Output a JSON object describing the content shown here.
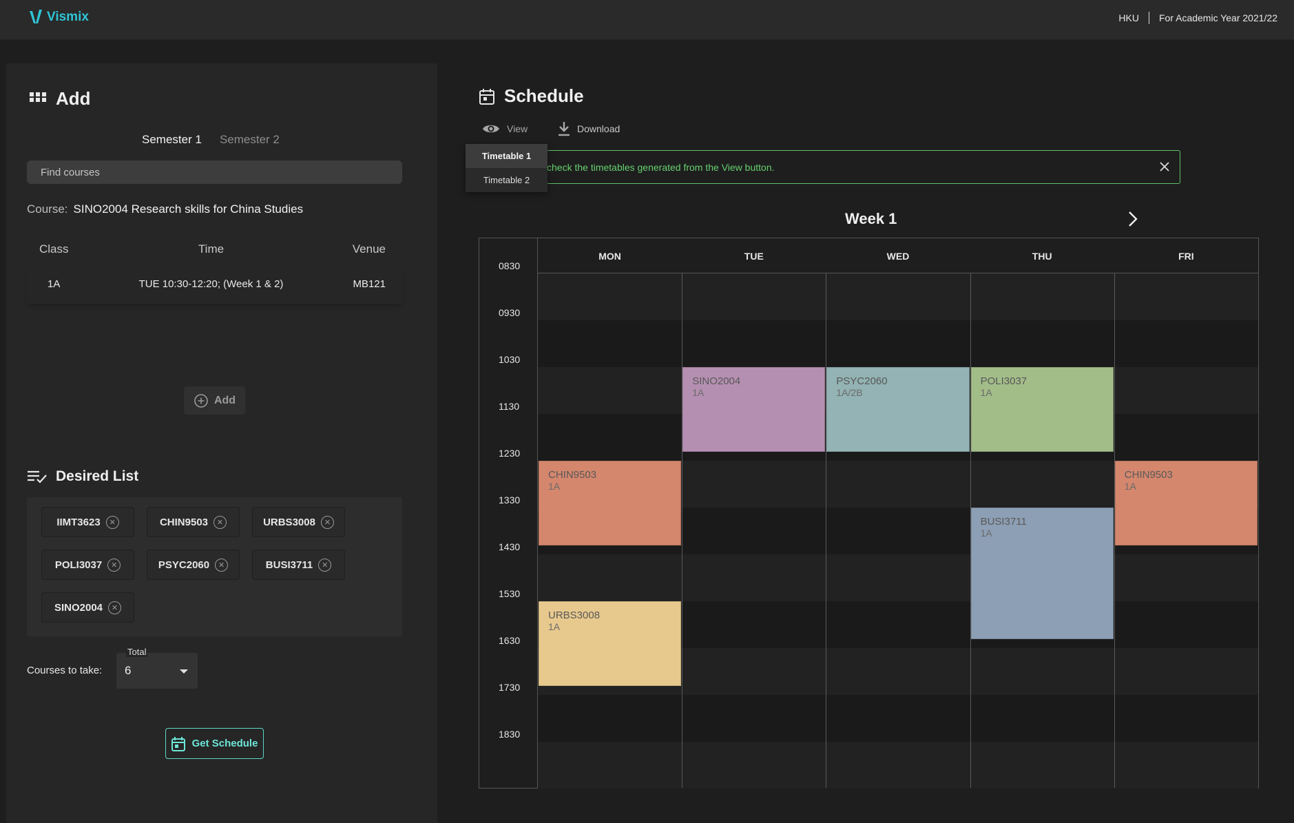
{
  "header": {
    "logo_text": "Vismix",
    "institution": "HKU",
    "academic_year": "For Academic Year 2021/22"
  },
  "add_panel": {
    "title": "Add",
    "semester_tabs": [
      {
        "label": "Semester 1",
        "active": true
      },
      {
        "label": "Semester 2",
        "active": false
      }
    ],
    "search_placeholder": "Find courses",
    "course_label": "Course:",
    "course_value": "SINO2004 Research skills for China Studies",
    "class_table": {
      "headers": [
        "Class",
        "Time",
        "Venue"
      ],
      "rows": [
        {
          "class": "1A",
          "time": "TUE 10:30-12:20; (Week 1 & 2)",
          "venue": "MB121"
        }
      ]
    },
    "add_button": "Add"
  },
  "desired_list": {
    "title": "Desired List",
    "items": [
      "IIMT3623",
      "CHIN9503",
      "URBS3008",
      "POLI3037",
      "PSYC2060",
      "BUSI3711",
      "SINO2004"
    ],
    "courses_to_take_label": "Courses to take:",
    "total_label": "Total",
    "total_value": "6",
    "get_schedule_button": "Get Schedule"
  },
  "schedule": {
    "title": "Schedule",
    "view_label": "View",
    "download_label": "Download",
    "dropdown": [
      {
        "label": "Timetable 1",
        "active": true
      },
      {
        "label": "Timetable 2",
        "active": false
      }
    ],
    "alert_text": "check the timetables generated from the View button.",
    "week_title": "Week 1",
    "days": [
      "MON",
      "TUE",
      "WED",
      "THU",
      "FRI"
    ],
    "times": [
      "0830",
      "0930",
      "1030",
      "1130",
      "1230",
      "1330",
      "1430",
      "1530",
      "1630",
      "1730",
      "1830"
    ],
    "events": [
      {
        "code": "SINO2004",
        "cls": "1A",
        "day": 1,
        "start": 2,
        "slots": 1.8,
        "color": "#b58fb1"
      },
      {
        "code": "PSYC2060",
        "cls": "1A/2B",
        "day": 2,
        "start": 2,
        "slots": 1.8,
        "color": "#93b3b4"
      },
      {
        "code": "POLI3037",
        "cls": "1A",
        "day": 3,
        "start": 2,
        "slots": 1.8,
        "color": "#a3bd89"
      },
      {
        "code": "CHIN9503",
        "cls": "1A",
        "day": 0,
        "start": 4,
        "slots": 1.8,
        "color": "#d4876d"
      },
      {
        "code": "CHIN9503",
        "cls": "1A",
        "day": 4,
        "start": 4,
        "slots": 1.8,
        "color": "#d4876d"
      },
      {
        "code": "BUSI3711",
        "cls": "1A",
        "day": 3,
        "start": 5,
        "slots": 2.8,
        "color": "#8d9fb4"
      },
      {
        "code": "URBS3008",
        "cls": "1A",
        "day": 0,
        "start": 7,
        "slots": 1.8,
        "color": "#e8c98d"
      }
    ]
  }
}
